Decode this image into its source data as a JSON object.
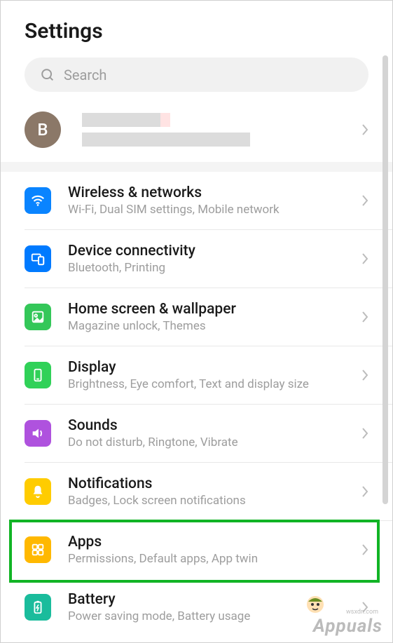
{
  "title": "Settings",
  "search": {
    "placeholder": "Search"
  },
  "account": {
    "initial": "B"
  },
  "items": [
    {
      "key": "wireless",
      "title": "Wireless & networks",
      "sub": "Wi-Fi, Dual SIM settings, Mobile network"
    },
    {
      "key": "device-conn",
      "title": "Device connectivity",
      "sub": "Bluetooth, Printing"
    },
    {
      "key": "home-screen",
      "title": "Home screen & wallpaper",
      "sub": "Magazine unlock, Themes"
    },
    {
      "key": "display",
      "title": "Display",
      "sub": "Brightness, Eye comfort, Text and display size"
    },
    {
      "key": "sounds",
      "title": "Sounds",
      "sub": "Do not disturb, Ringtone, Vibrate"
    },
    {
      "key": "notifications",
      "title": "Notifications",
      "sub": "Badges, Lock screen notifications"
    },
    {
      "key": "apps",
      "title": "Apps",
      "sub": "Permissions, Default apps, App twin"
    },
    {
      "key": "battery",
      "title": "Battery",
      "sub": "Power saving mode, Battery usage"
    }
  ],
  "watermark": {
    "text": "Appuals",
    "src": "wsxdn.com"
  }
}
